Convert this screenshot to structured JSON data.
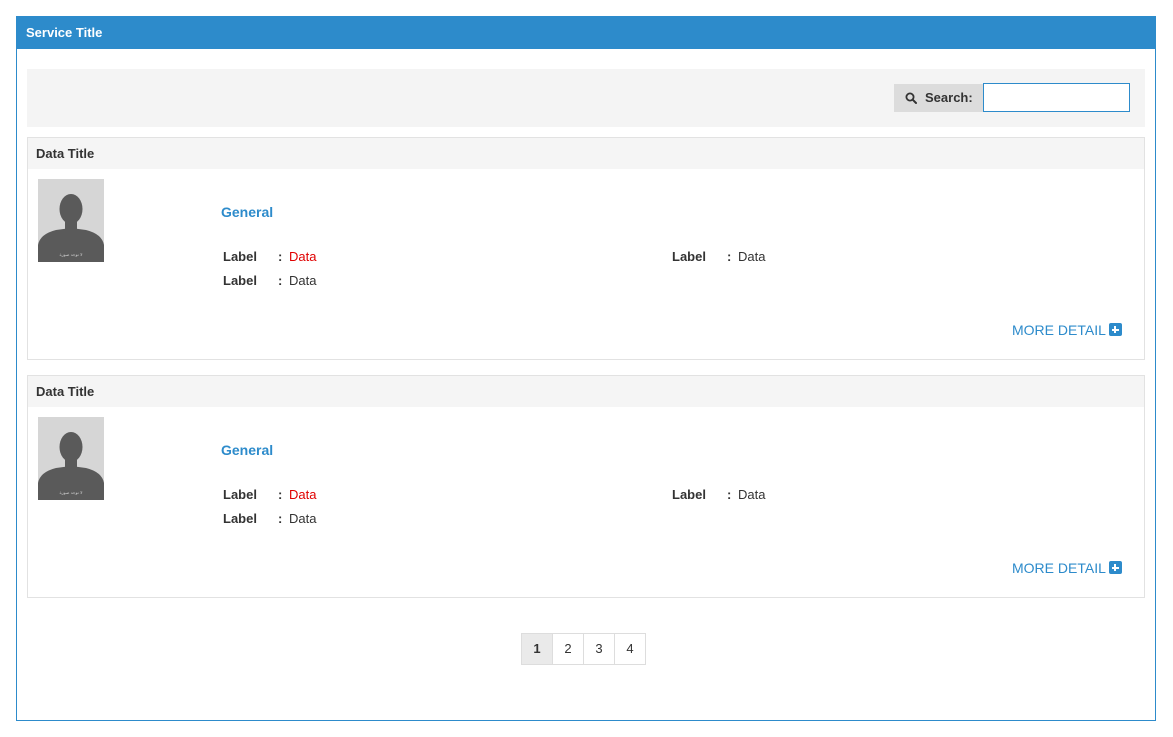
{
  "panel": {
    "title": "Service Title"
  },
  "search": {
    "label": "Search:",
    "value": "",
    "placeholder": ""
  },
  "cards": [
    {
      "title": "Data Title",
      "avatar_caption": "لا توجد صورة",
      "section": "General",
      "fields": [
        {
          "label": "Label",
          "value": "Data",
          "highlight": true
        },
        {
          "label": "Label",
          "value": "Data"
        },
        {
          "label": "Label",
          "value": "Data"
        }
      ],
      "more": "MORE DETAIL"
    },
    {
      "title": "Data Title",
      "avatar_caption": "لا توجد صورة",
      "section": "General",
      "fields": [
        {
          "label": "Label",
          "value": "Data",
          "highlight": true
        },
        {
          "label": "Label",
          "value": "Data"
        },
        {
          "label": "Label",
          "value": "Data"
        }
      ],
      "more": "MORE DETAIL"
    }
  ],
  "pagination": {
    "pages": [
      "1",
      "2",
      "3",
      "4"
    ],
    "active": "1"
  },
  "colors": {
    "accent": "#2d8bcb",
    "highlight": "#e00000"
  },
  "icons": {
    "search": "search-icon",
    "more": "plus-square-icon"
  }
}
